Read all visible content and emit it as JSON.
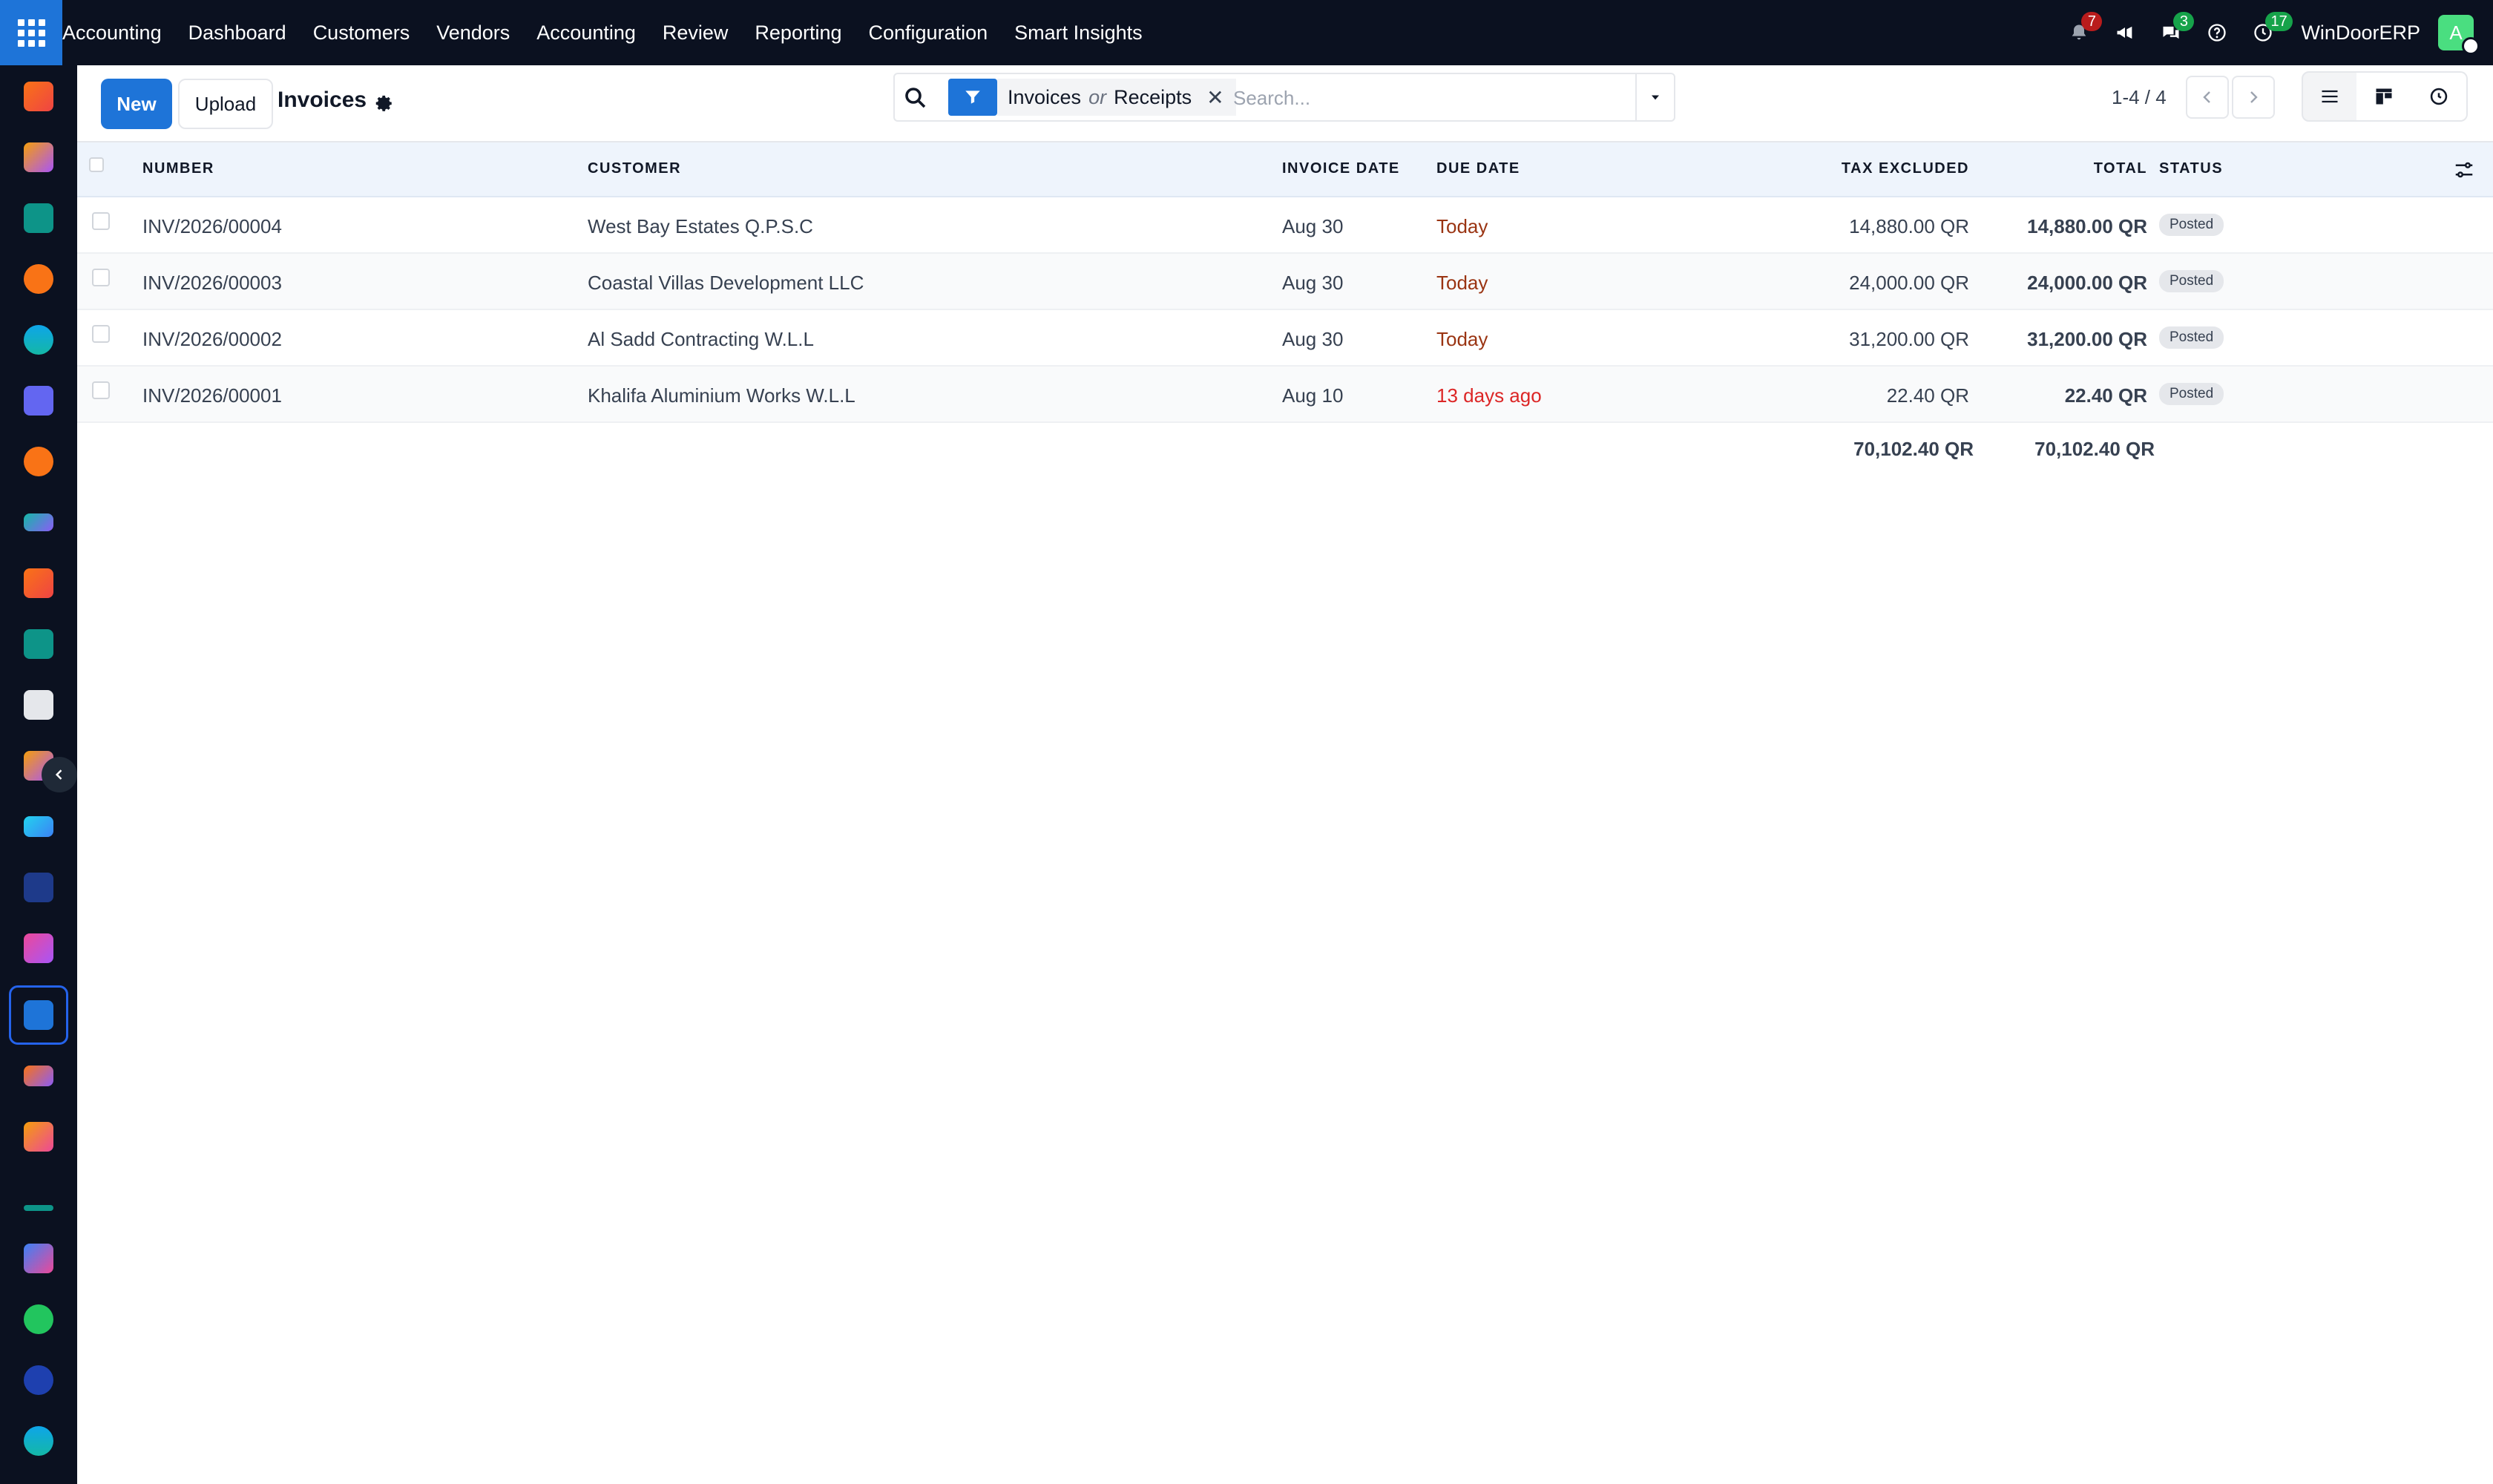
{
  "navbar": {
    "app_name": "Accounting",
    "menu": [
      "Dashboard",
      "Customers",
      "Vendors",
      "Accounting",
      "Review",
      "Reporting",
      "Configuration",
      "Smart Insights"
    ],
    "notifications_count": "7",
    "messages_count": "3",
    "activities_count": "17",
    "company_name": "WinDoorERP",
    "avatar_initial": "A"
  },
  "control": {
    "new_label": "New",
    "upload_label": "Upload",
    "title": "Invoices",
    "search": {
      "facet_a": "Invoices",
      "facet_or": "or",
      "facet_b": "Receipts",
      "remove_glyph": "✕",
      "placeholder": "Search..."
    },
    "pager": "1-4 / 4"
  },
  "table": {
    "headers": {
      "number": "NUMBER",
      "customer": "CUSTOMER",
      "invoice_date": "INVOICE DATE",
      "due_date": "DUE DATE",
      "tax_excluded": "TAX EXCLUDED",
      "total": "TOTAL",
      "status": "STATUS"
    },
    "rows": [
      {
        "number": "INV/2026/00004",
        "customer": "West Bay Estates Q.P.S.C",
        "invoice_date": "Aug 30",
        "due_date": "Today",
        "tax_excluded": "14,880.00 QR",
        "total": "14,880.00 QR",
        "status": "Posted"
      },
      {
        "number": "INV/2026/00003",
        "customer": "Coastal Villas Development LLC",
        "invoice_date": "Aug 30",
        "due_date": "Today",
        "tax_excluded": "24,000.00 QR",
        "total": "24,000.00 QR",
        "status": "Posted"
      },
      {
        "number": "INV/2026/00002",
        "customer": "Al Sadd Contracting W.L.L",
        "invoice_date": "Aug 30",
        "due_date": "Today",
        "tax_excluded": "31,200.00 QR",
        "total": "31,200.00 QR",
        "status": "Posted"
      },
      {
        "number": "INV/2026/00001",
        "customer": "Khalifa Aluminium Works W.L.L",
        "invoice_date": "Aug 10",
        "due_date": "13 days ago",
        "tax_excluded": "22.40 QR",
        "total": "22.40 QR",
        "status": "Posted"
      }
    ],
    "totals": {
      "tax_excluded": "70,102.40 QR",
      "total": "70,102.40 QR"
    }
  },
  "colors": {
    "navbar_bg": "#0b1120",
    "primary": "#1e74d8",
    "due_today": "#9a3412",
    "due_overdue": "#dc2626",
    "badge_red": "#b91c1c",
    "badge_green": "#16a34a"
  },
  "sidebar_icons": [
    "invoicing-icon",
    "field-service-icon",
    "contacts-icon",
    "discuss-icon",
    "website-icon",
    "email-marketing-icon",
    "livechat-icon",
    "surveys-icon",
    "invoicing-icon",
    "contacts-icon",
    "inventory-icon",
    "field-service-icon",
    "todo-icon",
    "knowledge-icon",
    "barcode-icon",
    "accounting-icon",
    "employees-icon",
    "calendar-icon",
    "sign-icon",
    "dashboards-icon",
    "whatsapp-icon",
    "timer-icon",
    "website-icon"
  ]
}
